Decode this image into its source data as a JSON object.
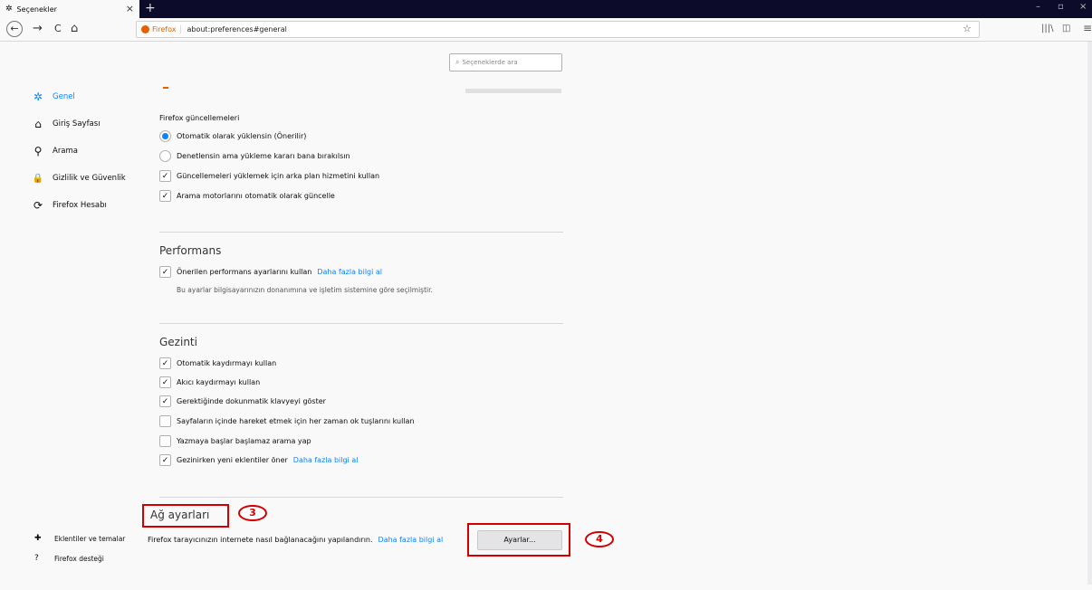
{
  "titlebar": {
    "tab_title": "Seçenekler",
    "tab_close": "×",
    "new_tab": "+",
    "win_min": "–",
    "win_max": "▫",
    "win_close": "×"
  },
  "navbar": {
    "back": "←",
    "forward": "→",
    "reload": "C",
    "home": "⌂",
    "identity": "Firefox",
    "url": "about:preferences#general",
    "bookmark_star": "☆",
    "library": "|||\\",
    "sidebar_toggle": "◫",
    "menu": "≡"
  },
  "search": {
    "placeholder": "Seçeneklerde ara",
    "icon": "⌕"
  },
  "sidebar": {
    "items": [
      {
        "label": "Genel",
        "icon": "gear-icon",
        "glyph": "✲"
      },
      {
        "label": "Giriş Sayfası",
        "icon": "home-icon",
        "glyph": "⌂"
      },
      {
        "label": "Arama",
        "icon": "search-icon",
        "glyph": "⚲"
      },
      {
        "label": "Gizlilik ve Güvenlik",
        "icon": "lock-icon",
        "glyph": "🔒"
      },
      {
        "label": "Firefox Hesabı",
        "icon": "sync-icon",
        "glyph": "⟳"
      }
    ],
    "footer": [
      {
        "label": "Eklentiler ve temalar",
        "icon": "puzzle-icon",
        "glyph": "✚"
      },
      {
        "label": "Firefox desteği",
        "icon": "help-icon",
        "glyph": "?"
      }
    ]
  },
  "updates": {
    "heading": "Firefox güncellemeleri",
    "radio_auto": "Otomatik olarak yüklensin (Önerilir)",
    "radio_check": "Denetlensin ama yükleme kararı bana bırakılsın",
    "cb_background": "Güncellemeleri yüklemek için arka plan hizmetini kullan",
    "cb_search_engines": "Arama motorlarını otomatik olarak güncelle"
  },
  "performance": {
    "heading": "Performans",
    "cb_recommended": "Önerilen performans ayarlarını kullan",
    "learn_more": "Daha fazla bilgi al",
    "note": "Bu ayarlar bilgisayarınızın donanımına ve işletim sistemine göre seçilmiştir."
  },
  "browsing": {
    "heading": "Gezinti",
    "items": [
      {
        "label": "Otomatik kaydırmayı kullan",
        "checked": true
      },
      {
        "label": "Akıcı kaydırmayı kullan",
        "checked": true
      },
      {
        "label": "Gerektiğinde dokunmatik klavyeyi göster",
        "checked": true
      },
      {
        "label": "Sayfaların içinde hareket etmek için her zaman ok tuşlarını kullan",
        "checked": false
      },
      {
        "label": "Yazmaya başlar başlamaz arama yap",
        "checked": false
      },
      {
        "label": "Gezinirken yeni eklentiler öner",
        "checked": true
      }
    ],
    "learn_more": "Daha fazla bilgi al"
  },
  "network": {
    "heading": "Ağ ayarları",
    "description": "Firefox tarayıcınızın internete nasıl bağlanacağını yapılandırın.",
    "learn_more": "Daha fazla bilgi al",
    "settings_button": "Ayarlar..."
  },
  "annotations": {
    "badge_3": "3",
    "badge_4": "4",
    "color": "#d20000"
  },
  "colors": {
    "accent": "#0a84ff",
    "firefox_orange": "#e66000",
    "titlebar": "#0c0c2a"
  },
  "check_glyph": "✓"
}
